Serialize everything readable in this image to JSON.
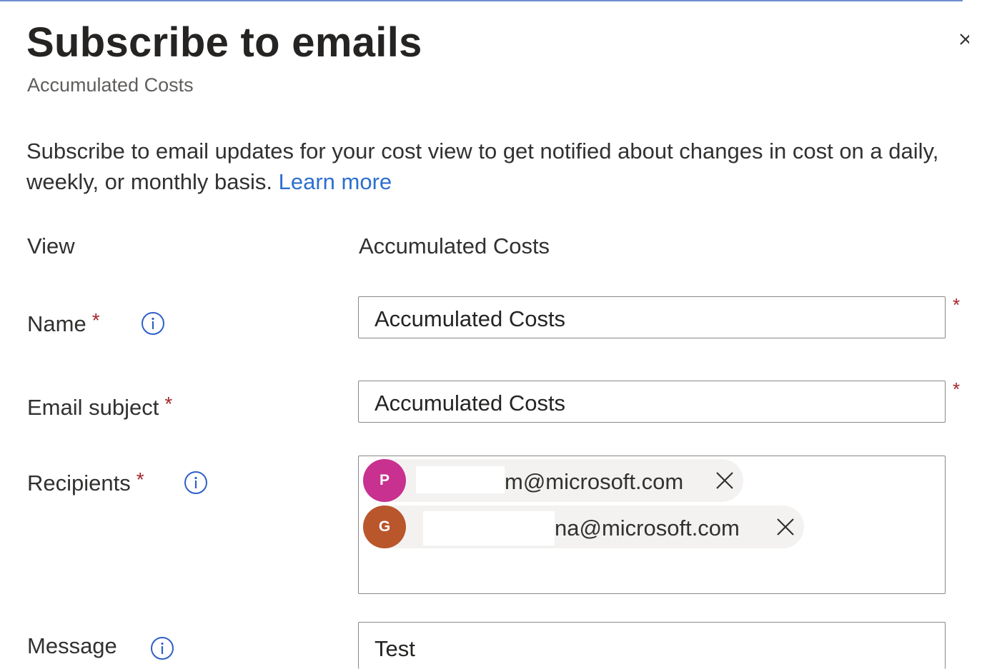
{
  "panel": {
    "title": "Subscribe to emails",
    "subtitle": "Accumulated Costs",
    "description": "Subscribe to email updates for your cost view to get notified about changes in cost on a daily, weekly, or monthly basis.",
    "learn_more": "Learn more"
  },
  "form": {
    "required_marker": "*",
    "view": {
      "label": "View",
      "value": "Accumulated Costs"
    },
    "name": {
      "label": "Name",
      "value": "Accumulated Costs"
    },
    "email_subject": {
      "label": "Email subject",
      "value": "Accumulated Costs"
    },
    "recipients": {
      "label": "Recipients",
      "items": [
        {
          "initial": "P",
          "email_visible": "m@microsoft.com",
          "avatar_color": "#c8318f"
        },
        {
          "initial": "G",
          "email_visible": "na@microsoft.com",
          "avatar_color": "#b9562b"
        }
      ]
    },
    "message": {
      "label": "Message",
      "value": "Test"
    }
  },
  "colors": {
    "link": "#2d6fcf",
    "required": "#a4262c",
    "info_icon": "#2f5fc9",
    "input_border": "#8a8886"
  }
}
